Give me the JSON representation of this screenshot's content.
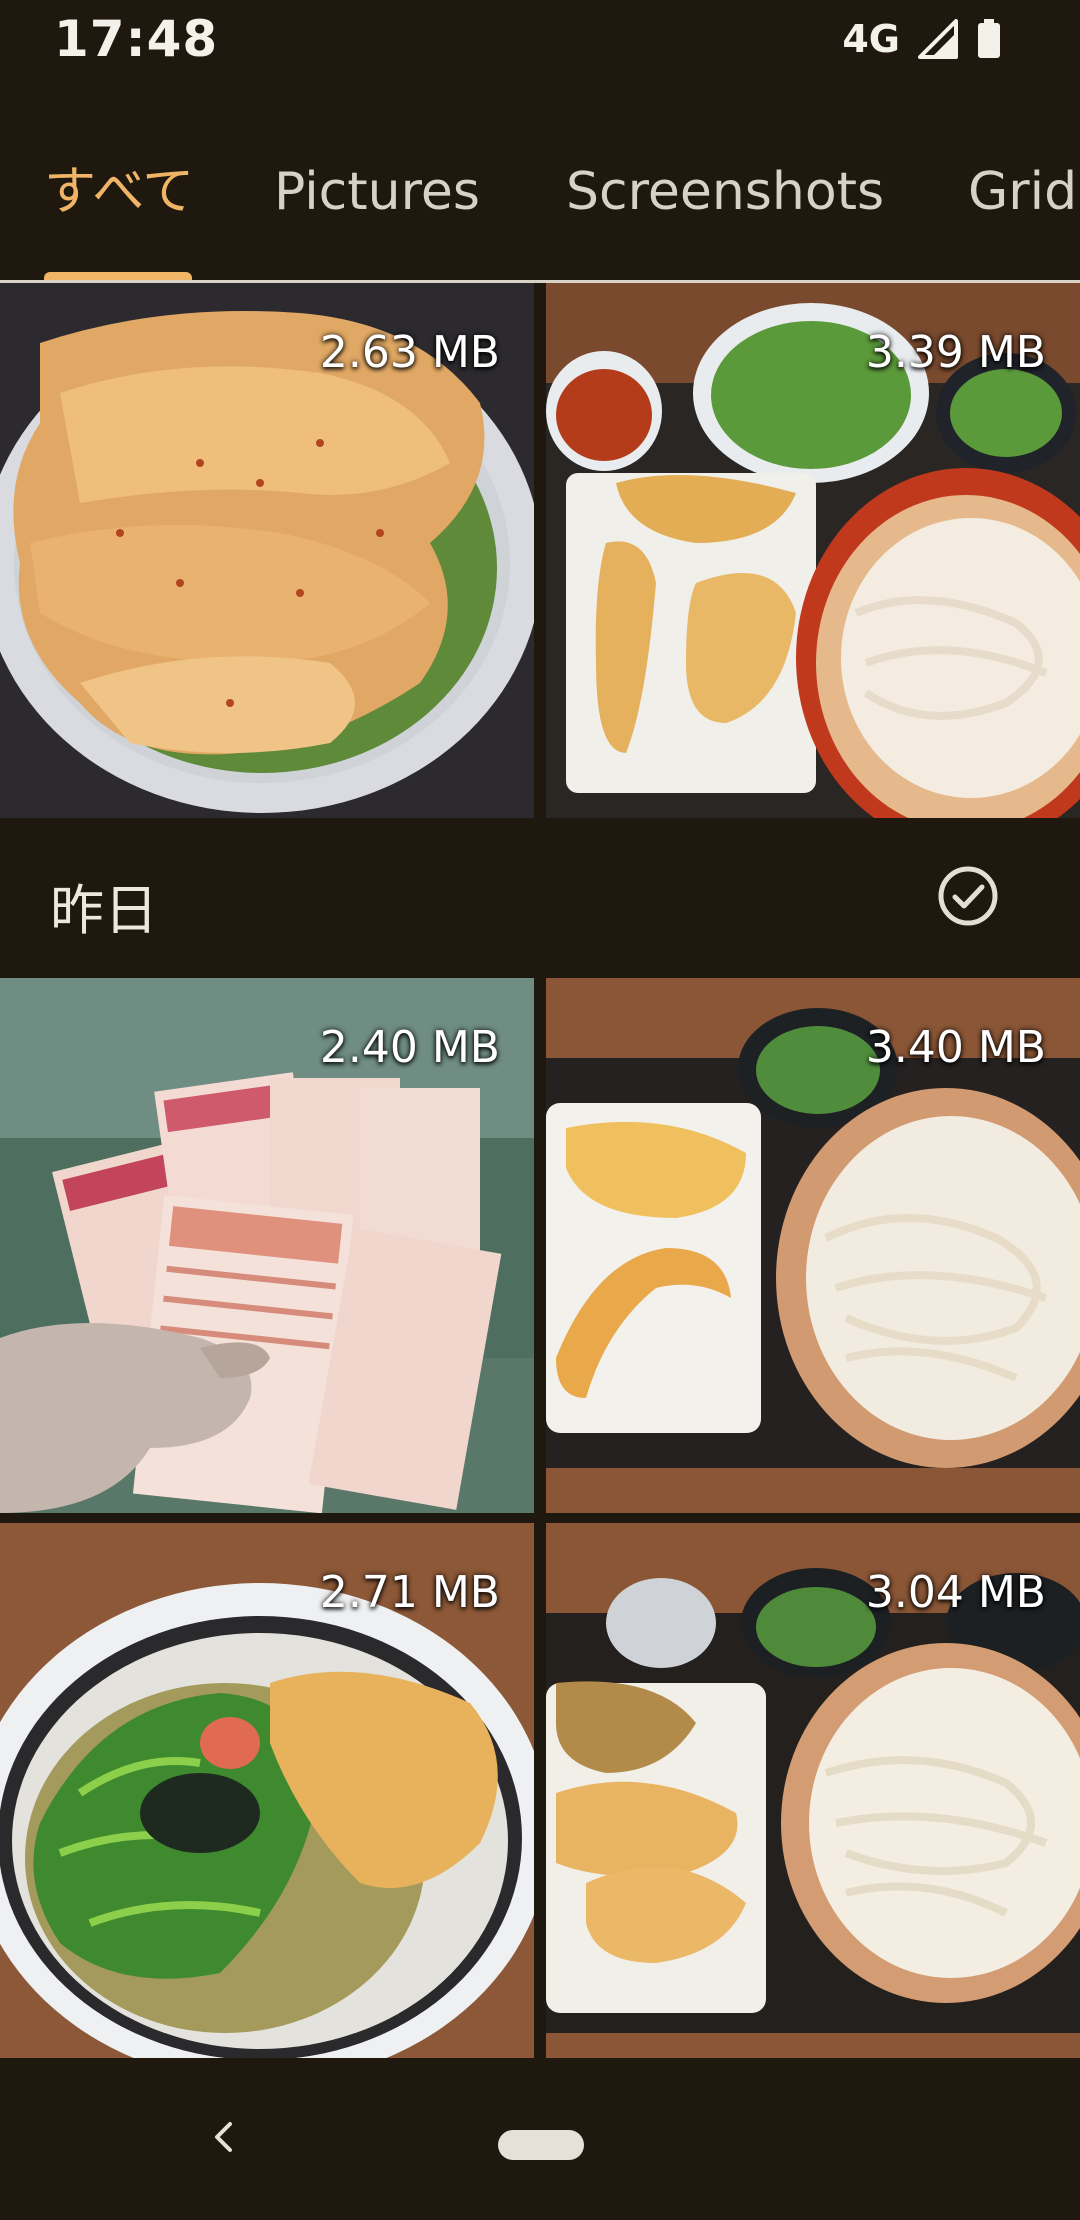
{
  "status_bar": {
    "time": "17:48",
    "network": "4G"
  },
  "tabs": [
    {
      "label": "すべて",
      "active": true
    },
    {
      "label": "Pictures",
      "active": false
    },
    {
      "label": "Screenshots",
      "active": false
    },
    {
      "label": "Grid",
      "active": false
    }
  ],
  "section": {
    "title": "昨日"
  },
  "photos": [
    {
      "size": "2.63 MB"
    },
    {
      "size": "3.39 MB"
    },
    {
      "size": "2.40 MB"
    },
    {
      "size": "3.40 MB"
    },
    {
      "size": "2.71 MB"
    },
    {
      "size": "3.04 MB"
    }
  ],
  "colors": {
    "background": "#1e180e",
    "accent": "#f0b467",
    "tab_text": "#d8d2c6"
  },
  "icons": {
    "signal": "signal-icon",
    "battery": "battery-icon",
    "select_all": "check-circle-icon",
    "back": "back-icon",
    "home": "home-pill"
  }
}
